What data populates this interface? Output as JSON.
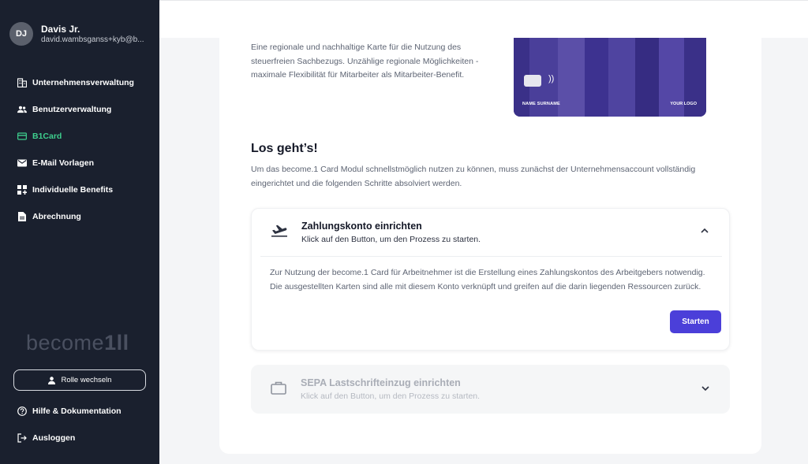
{
  "user": {
    "initials": "DJ",
    "name": "Davis Jr.",
    "email": "david.wambsganss+kyb@b..."
  },
  "sidebar": {
    "items": [
      {
        "label": "Unternehmensverwaltung",
        "icon": "building-icon"
      },
      {
        "label": "Benutzerverwaltung",
        "icon": "users-icon"
      },
      {
        "label": "B1Card",
        "icon": "credit-card-icon",
        "active": true
      },
      {
        "label": "E-Mail Vorlagen",
        "icon": "mail-icon"
      },
      {
        "label": "Individuelle Benefits",
        "icon": "grid-plus-icon"
      },
      {
        "label": "Abrechnung",
        "icon": "document-icon"
      }
    ],
    "brand_text": "become",
    "brand_mark": "1ll",
    "role_button": "Rolle wechseln",
    "help": "Hilfe & Dokumentation",
    "logout": "Ausloggen"
  },
  "intro": {
    "text": "Eine regionale und nachhaltige Karte für die Nutzung des steuerfreien Sachbezugs. Unzählige regionale Möglichkeiten - maximale Flexibilität für Mitarbeiter als Mitarbeiter-Benefit."
  },
  "card": {
    "name": "NAME SURNAME",
    "logo": "YOUR LOGO",
    "nfc": "))"
  },
  "section": {
    "title": "Los geht’s!",
    "description": "Um das become.1 Card Modul schnellstmöglich nutzen zu können, muss zunächst der Unternehmensaccount vollständig eingerichtet und die folgenden Schritte absolviert werden."
  },
  "steps": [
    {
      "title": "Zahlungskonto einrichten",
      "subtitle": "Klick auf den Button, um den Prozess zu starten.",
      "body": "Zur Nutzung der become.1 Card für Arbeitnehmer ist die Erstellung eines Zahlungskontos des Arbeitgebers notwendig. Die ausgestellten Karten sind alle mit diesem Konto verknüpft und greifen auf die darin liegenden Ressourcen zurück.",
      "button": "Starten",
      "expanded": true
    },
    {
      "title": "SEPA Lastschrifteinzug einrichten",
      "subtitle": "Klick auf den Button, um den Prozess zu starten.",
      "expanded": false
    }
  ],
  "colors": {
    "sidebar_bg": "#1a202e",
    "active": "#3ecf8e",
    "accent": "#4b3fd9",
    "card": "#3a3088"
  }
}
